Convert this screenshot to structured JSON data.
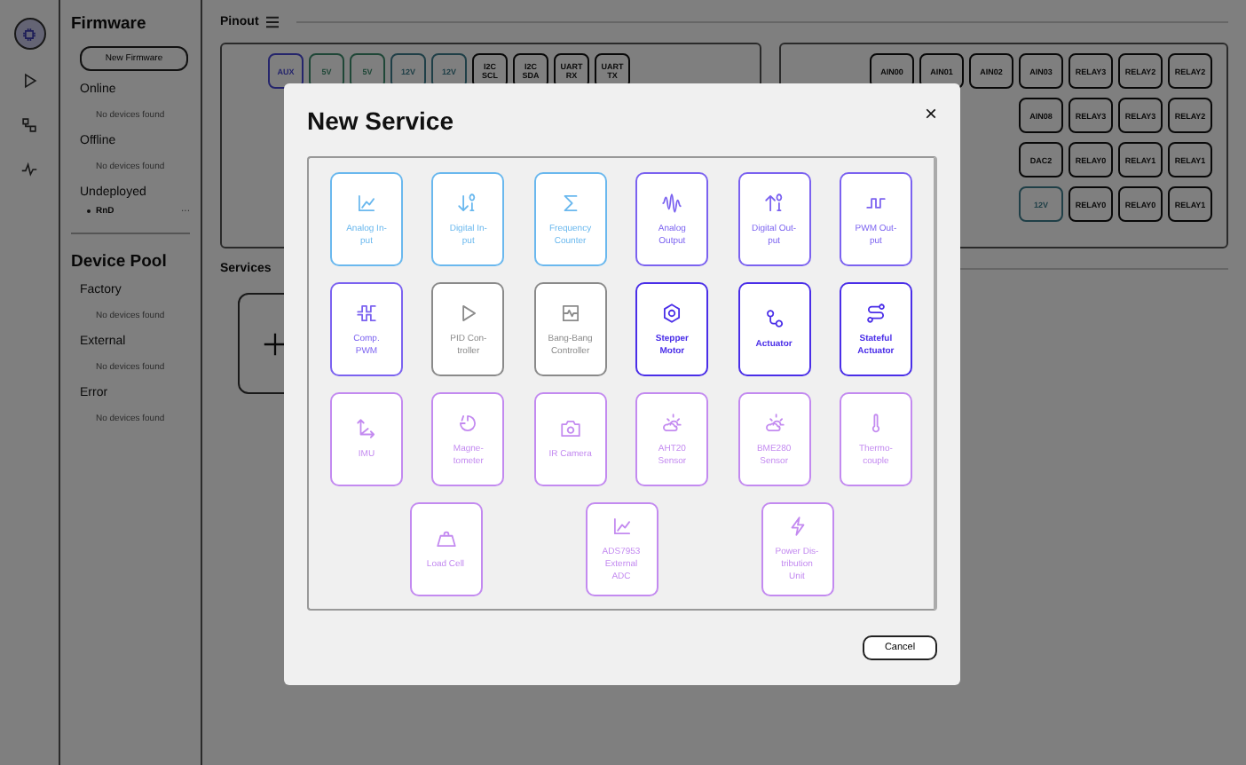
{
  "rail": {
    "items": [
      {
        "selected": true
      },
      {
        "selected": false
      },
      {
        "selected": false
      },
      {
        "selected": false
      }
    ]
  },
  "sidebar": {
    "sections": [
      {
        "title": "Firmware",
        "button": "New Firmware",
        "groups": [
          {
            "label": "Online",
            "empty": "No devices found"
          },
          {
            "label": "Offline",
            "empty": "No devices found"
          },
          {
            "label": "Undeployed",
            "items": [
              {
                "name": "RnD",
                "more": "···"
              }
            ]
          }
        ]
      },
      {
        "title": "Device Pool",
        "groups": [
          {
            "label": "Factory",
            "empty": "No devices found"
          },
          {
            "label": "External",
            "empty": "No devices found"
          },
          {
            "label": "Error",
            "empty": "No devices found"
          }
        ]
      }
    ]
  },
  "pinout": {
    "title": "Pinout",
    "left_rows": [
      [
        {
          "label": "AUX",
          "kind": "aux"
        },
        {
          "label": "5V",
          "kind": "v5"
        },
        {
          "label": "5V",
          "kind": "v5"
        },
        {
          "label": "12V",
          "kind": "v12"
        },
        {
          "label": "12V",
          "kind": "v12"
        },
        {
          "label": "I2C SCL",
          "kind": "signal"
        },
        {
          "label": "I2C SDA",
          "kind": "signal"
        },
        {
          "label": "UART RX",
          "kind": "signal"
        },
        {
          "label": "UART TX",
          "kind": "signal"
        }
      ]
    ],
    "right_rows": [
      [
        {
          "label": "AIN00",
          "kind": "signal"
        },
        {
          "label": "AIN01",
          "kind": "signal"
        },
        {
          "label": "AIN02",
          "kind": "signal"
        },
        {
          "label": "AIN03",
          "kind": "signal"
        },
        {
          "label": "RELAY3",
          "kind": "signal"
        },
        {
          "label": "RELAY2",
          "kind": "signal"
        },
        {
          "label": "RELAY2",
          "kind": "signal"
        }
      ],
      [
        {
          "label": "AIN08",
          "kind": "signal"
        },
        {
          "label": "RELAY3",
          "kind": "signal"
        },
        {
          "label": "RELAY3",
          "kind": "signal"
        },
        {
          "label": "RELAY2",
          "kind": "signal"
        }
      ],
      [
        {
          "label": "DAC2",
          "kind": "signal"
        },
        {
          "label": "RELAY0",
          "kind": "signal"
        },
        {
          "label": "RELAY1",
          "kind": "signal"
        },
        {
          "label": "RELAY1",
          "kind": "signal"
        }
      ],
      [
        {
          "label": "12V",
          "kind": "v12"
        },
        {
          "label": "RELAY0",
          "kind": "signal"
        },
        {
          "label": "RELAY0",
          "kind": "signal"
        },
        {
          "label": "RELAY1",
          "kind": "signal"
        }
      ]
    ]
  },
  "services": {
    "title": "Services"
  },
  "dialog": {
    "title": "New Service",
    "close": "×",
    "cancel": "Cancel",
    "rows": [
      [
        {
          "label": "Analog In-put",
          "color": "#6ab8ee"
        },
        {
          "label": "Digital In-put",
          "color": "#6ab8ee"
        },
        {
          "label": "Frequency Counter",
          "color": "#6ab8ee"
        },
        {
          "label": "Analog Output",
          "color": "#7b62f0"
        },
        {
          "label": "Digital Out-put",
          "color": "#7b62f0"
        },
        {
          "label": "PWM Out-put",
          "color": "#7b62f0"
        }
      ],
      [
        {
          "label": "Comp. PWM",
          "color": "#7b62f0"
        },
        {
          "label": "PID Con-troller",
          "color": "#8a8a8a"
        },
        {
          "label": "Bang-Bang Controller",
          "color": "#8a8a8a"
        },
        {
          "label": "Stepper Motor",
          "color": "#4a2ee8"
        },
        {
          "label": "Actuator",
          "color": "#4a2ee8"
        },
        {
          "label": "Stateful Actuator",
          "color": "#4a2ee8"
        }
      ],
      [
        {
          "label": "IMU",
          "color": "#c38af0"
        },
        {
          "label": "Magne-tometer",
          "color": "#c38af0"
        },
        {
          "label": "IR Camera",
          "color": "#c38af0"
        },
        {
          "label": "AHT20 Sensor",
          "color": "#c38af0"
        },
        {
          "label": "BME280 Sensor",
          "color": "#c38af0"
        },
        {
          "label": "Thermo-couple",
          "color": "#c38af0"
        }
      ]
    ],
    "extra_tiles": [
      {
        "label": "Load Cell",
        "color": "#c38af0"
      },
      {
        "label": "ADS7953 External ADC",
        "color": "#c38af0"
      },
      {
        "label": "Power Dis-tribution Unit",
        "color": "#c38af0"
      }
    ]
  }
}
